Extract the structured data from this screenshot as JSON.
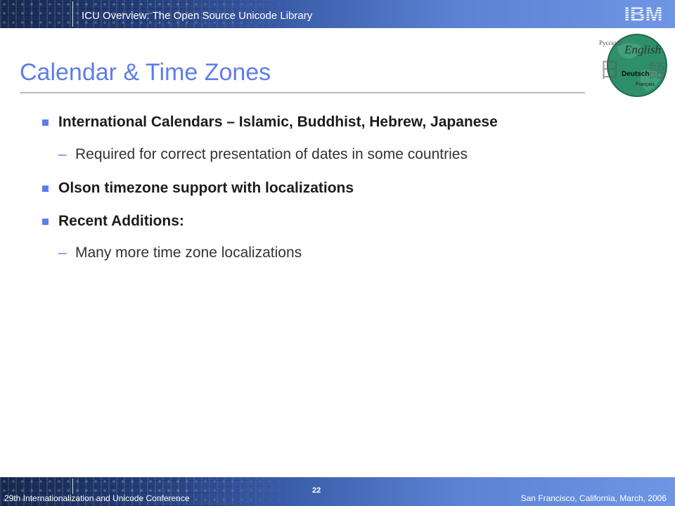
{
  "header": {
    "title": "ICU Overview: The Open Source Unicode Library",
    "logo": "IBM"
  },
  "slide": {
    "title": "Calendar & Time Zones",
    "accent_color": "#5f7de9",
    "bullets": [
      {
        "text": "International Calendars – Islamic, Buddhist, Hebrew, Japanese",
        "subs": [
          "Required for correct presentation of dates in some countries"
        ]
      },
      {
        "text": "Olson timezone support with localizations",
        "subs": []
      },
      {
        "text": "Recent Additions:",
        "subs": [
          "Many more time zone localizations"
        ]
      }
    ],
    "sub_marker": "–"
  },
  "globe_logo": {
    "words": [
      "Русский",
      "English",
      "Deutsch",
      "Français"
    ]
  },
  "footer": {
    "left": "29th Internationalization  and Unicode Conference",
    "page_number": "22",
    "right": "San Francisco, California, March, 2006"
  }
}
